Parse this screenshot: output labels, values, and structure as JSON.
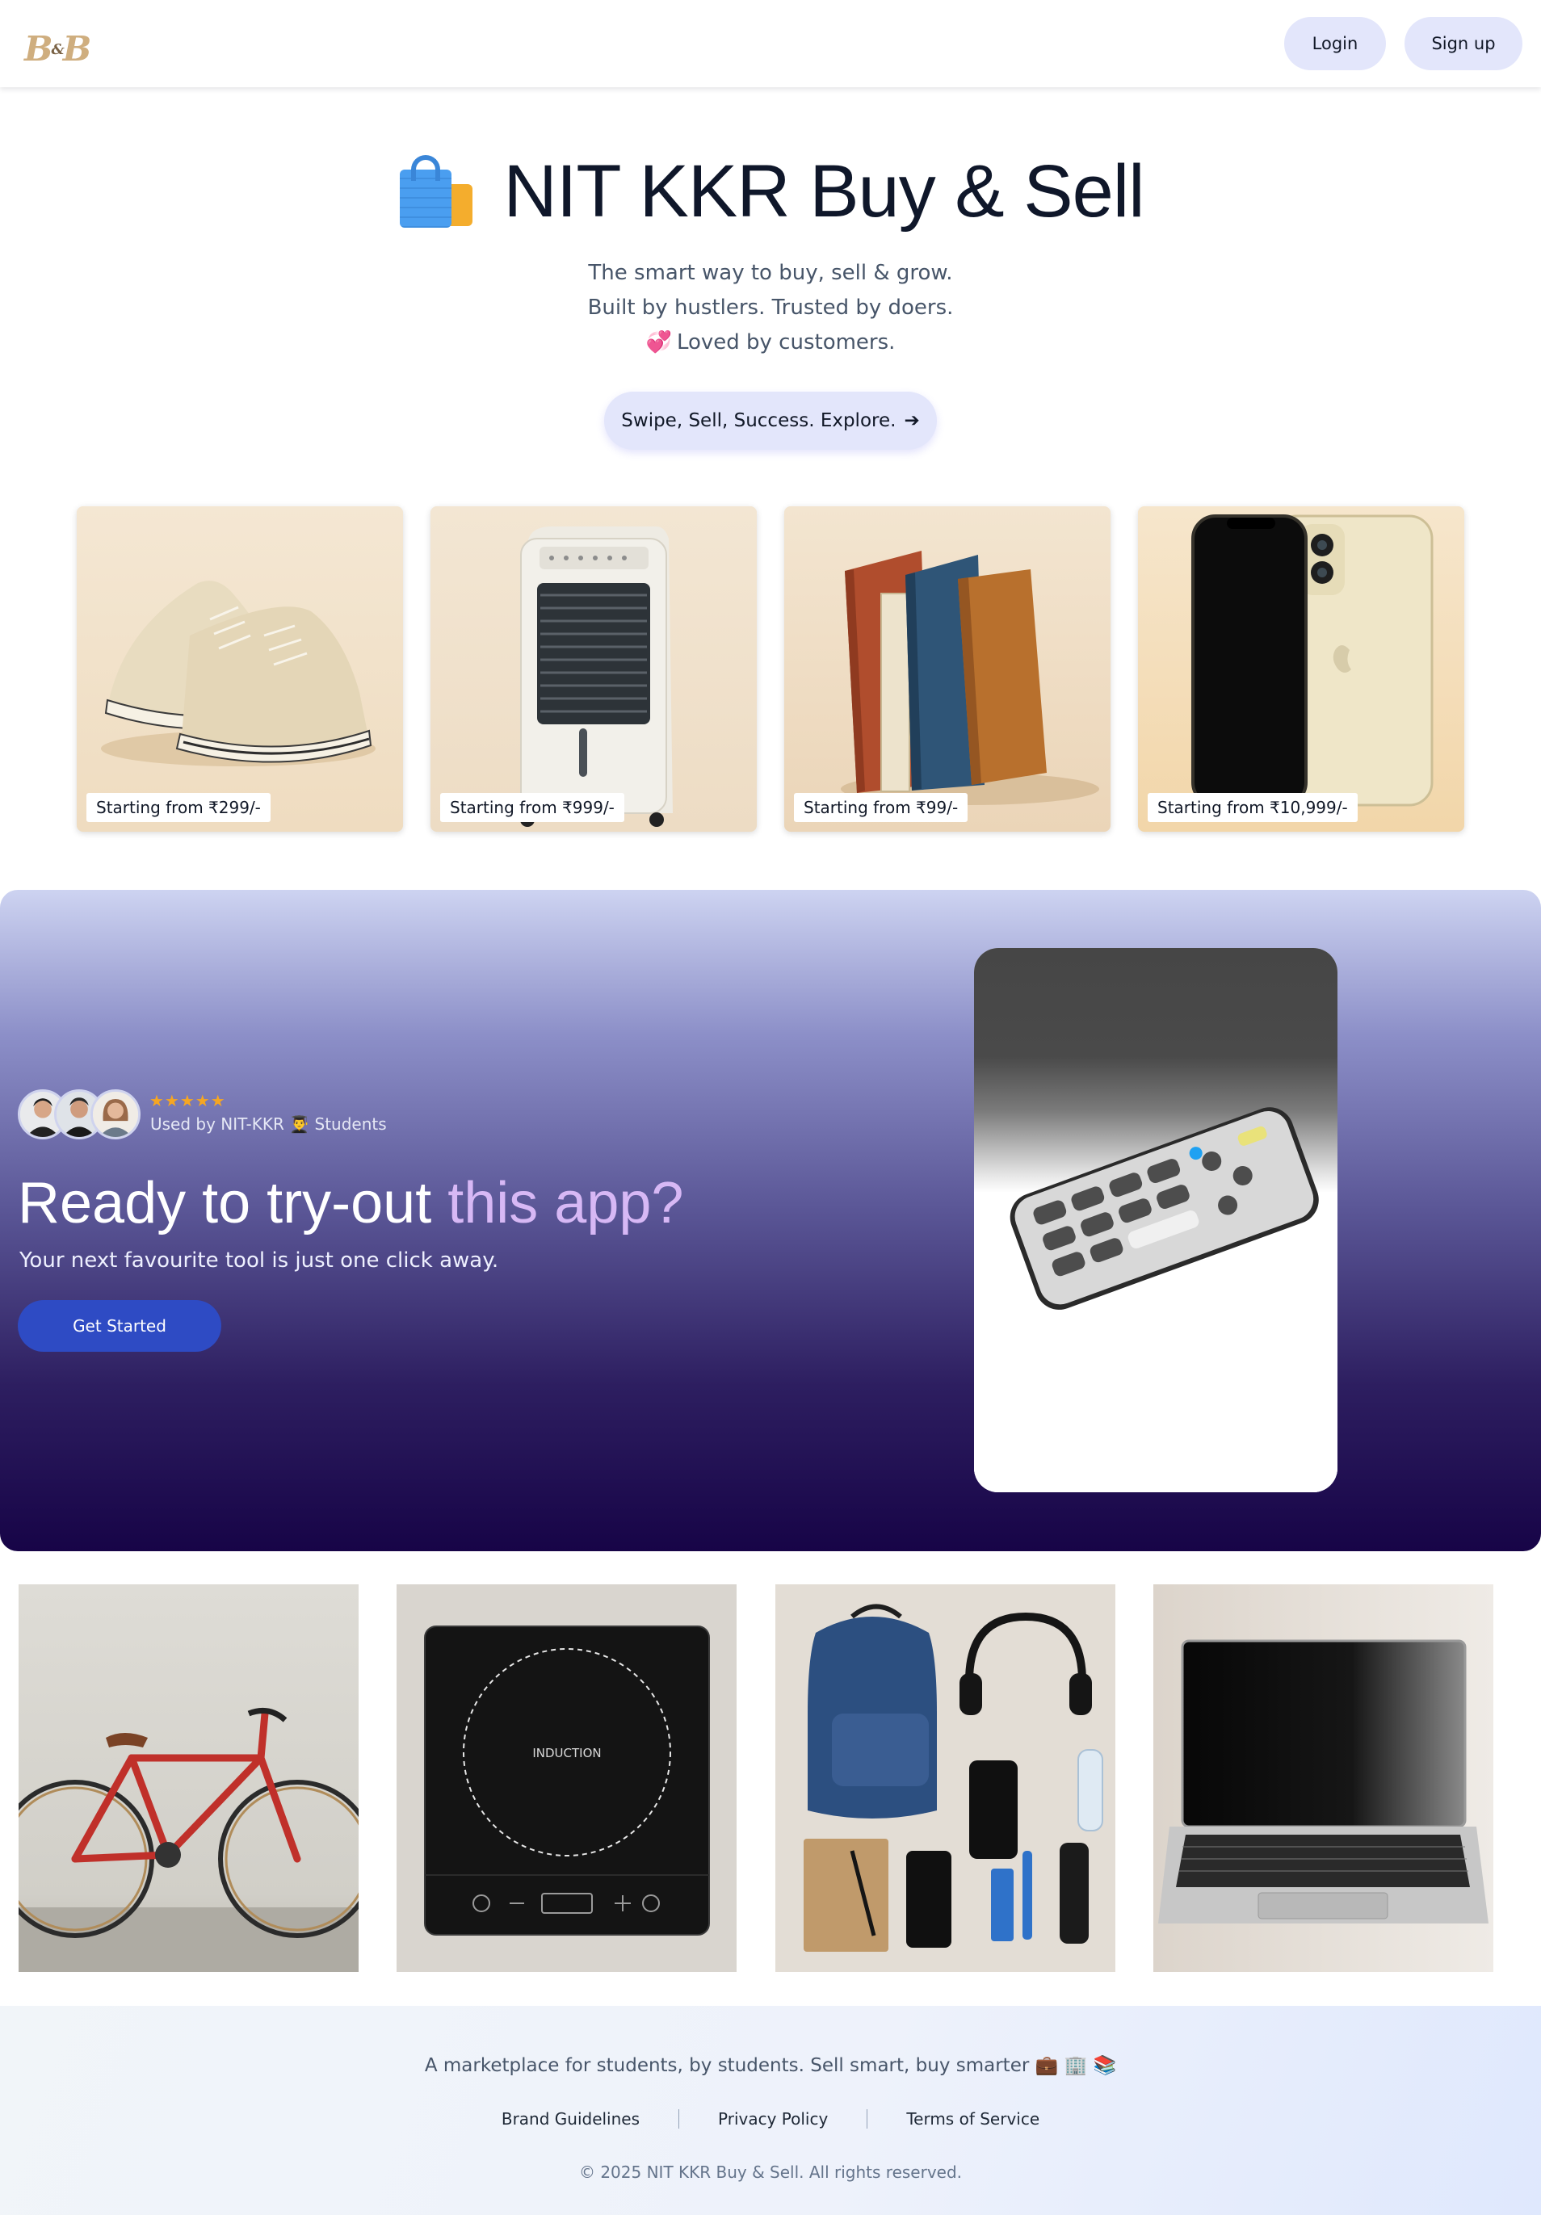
{
  "header": {
    "logo": {
      "left": "B",
      "amp": "&",
      "right": "B",
      "color": "#cfae7f"
    },
    "login_label": "Login",
    "signup_label": "Sign up"
  },
  "hero": {
    "icon": "shopping-bags-icon",
    "title": "NIT KKR Buy & Sell",
    "tagline_1": "The smart way to buy, sell & grow.",
    "tagline_2": "Built by hustlers. Trusted by doers.",
    "tagline_3": "Loved by customers.",
    "tagline_3_icon": "💞",
    "cta_label": "Swipe, Sell, Success. Explore.",
    "cta_arrow": "➔"
  },
  "products": [
    {
      "item": "sneakers",
      "price_label": "Starting from ₹299/-"
    },
    {
      "item": "air-cooler",
      "price_label": "Starting from ₹999/-"
    },
    {
      "item": "books",
      "price_label": "Starting from ₹99/-"
    },
    {
      "item": "iphone",
      "price_label": "Starting from ₹10,999/-"
    }
  ],
  "promo": {
    "rating_stars": "★★★★★",
    "used_by": "Used by NIT-KKR 👨‍🎓 Students",
    "title_main": "Ready to try-out ",
    "title_accent": "this app?",
    "subtitle": "Your next favourite tool is just one click away.",
    "button_label": "Get Started",
    "colors": {
      "accent_text": "#d7b8f5",
      "button": "#2e4bc4",
      "stars": "#f5a623"
    }
  },
  "gallery": [
    {
      "item": "bicycle"
    },
    {
      "item": "induction-cooktop",
      "label": "INDUCTION"
    },
    {
      "item": "student-essentials"
    },
    {
      "item": "laptop"
    }
  ],
  "footer": {
    "tagline": "A marketplace for students, by students. Sell smart, buy smarter 💼 🏢 📚",
    "links": [
      "Brand Guidelines",
      "Privacy Policy",
      "Terms of Service"
    ],
    "copyright": "© 2025 NIT KKR Buy & Sell. All rights reserved."
  }
}
